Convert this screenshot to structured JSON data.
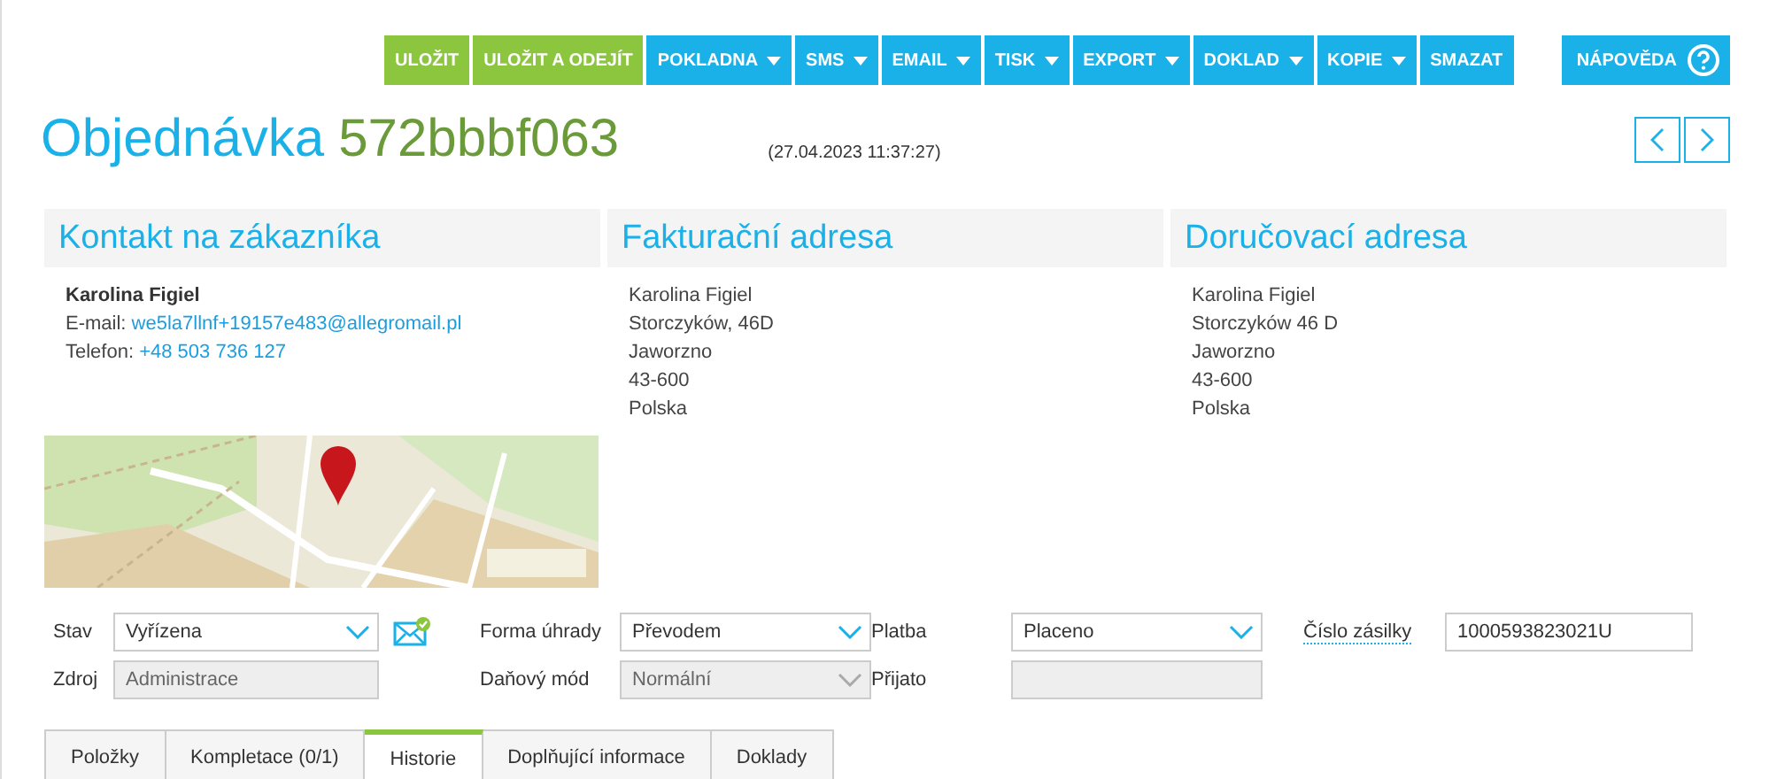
{
  "toolbar": [
    {
      "label": "ULOŽIT",
      "kind": "save",
      "dropdown": false
    },
    {
      "label": "ULOŽIT A ODEJÍT",
      "kind": "save",
      "dropdown": false
    },
    {
      "label": "POKLADNA",
      "kind": "action",
      "dropdown": true
    },
    {
      "label": "SMS",
      "kind": "action",
      "dropdown": true
    },
    {
      "label": "EMAIL",
      "kind": "action",
      "dropdown": true
    },
    {
      "label": "TISK",
      "kind": "action",
      "dropdown": true
    },
    {
      "label": "EXPORT",
      "kind": "action",
      "dropdown": true
    },
    {
      "label": "DOKLAD",
      "kind": "action",
      "dropdown": true
    },
    {
      "label": "KOPIE",
      "kind": "action",
      "dropdown": true
    },
    {
      "label": "SMAZAT",
      "kind": "action",
      "dropdown": false
    }
  ],
  "help_button": {
    "label": "NÁPOVĚDA"
  },
  "header": {
    "title": "Objednávka",
    "order_number": "572bbbf063",
    "date": "(27.04.2023 11:37:27)"
  },
  "contact": {
    "title": "Kontakt na zákazníka",
    "name": "Karolina Figiel",
    "email_label": "E-mail:",
    "email": "we5la7llnf+19157e483@allegromail.pl",
    "phone_label": "Telefon:",
    "phone": "+48 503 736 127"
  },
  "addresses": [
    {
      "title": "Fakturační adresa",
      "lines": [
        "Karolina Figiel",
        "Storczyków, 46D",
        "Jaworzno",
        "43-600",
        "Polska"
      ]
    },
    {
      "title": "Doručovací adresa",
      "lines": [
        "Karolina Figiel",
        "Storczyków 46 D",
        "Jaworzno",
        "43-600",
        "Polska"
      ]
    }
  ],
  "form": [
    [
      {
        "label": "Stav",
        "kind": "select",
        "value": "Vyřízena",
        "disabled": false,
        "email_icon": true
      },
      {
        "label": "Forma úhrady",
        "kind": "select",
        "value": "Převodem",
        "disabled": false
      },
      {
        "label": "Platba",
        "kind": "select",
        "value": "Placeno",
        "disabled": false
      },
      {
        "label": "Číslo zásilky",
        "kind": "input",
        "value": "1000593823021U",
        "disabled": false,
        "link": true
      }
    ],
    [
      {
        "label": "Zdroj",
        "kind": "input",
        "value": "Administrace",
        "disabled": true
      },
      {
        "label": "Daňový mód",
        "kind": "select",
        "value": "Normální",
        "disabled": true
      },
      {
        "label": "Přijato",
        "kind": "input",
        "disabled": true
      }
    ]
  ],
  "tabs": [
    {
      "label": "Položky",
      "selected": false
    },
    {
      "label": "Kompletace (0/1)",
      "selected": false
    },
    {
      "label": "Historie",
      "selected": true
    },
    {
      "label": "Doplňující informace",
      "selected": false
    },
    {
      "label": "Doklady",
      "selected": false
    }
  ]
}
